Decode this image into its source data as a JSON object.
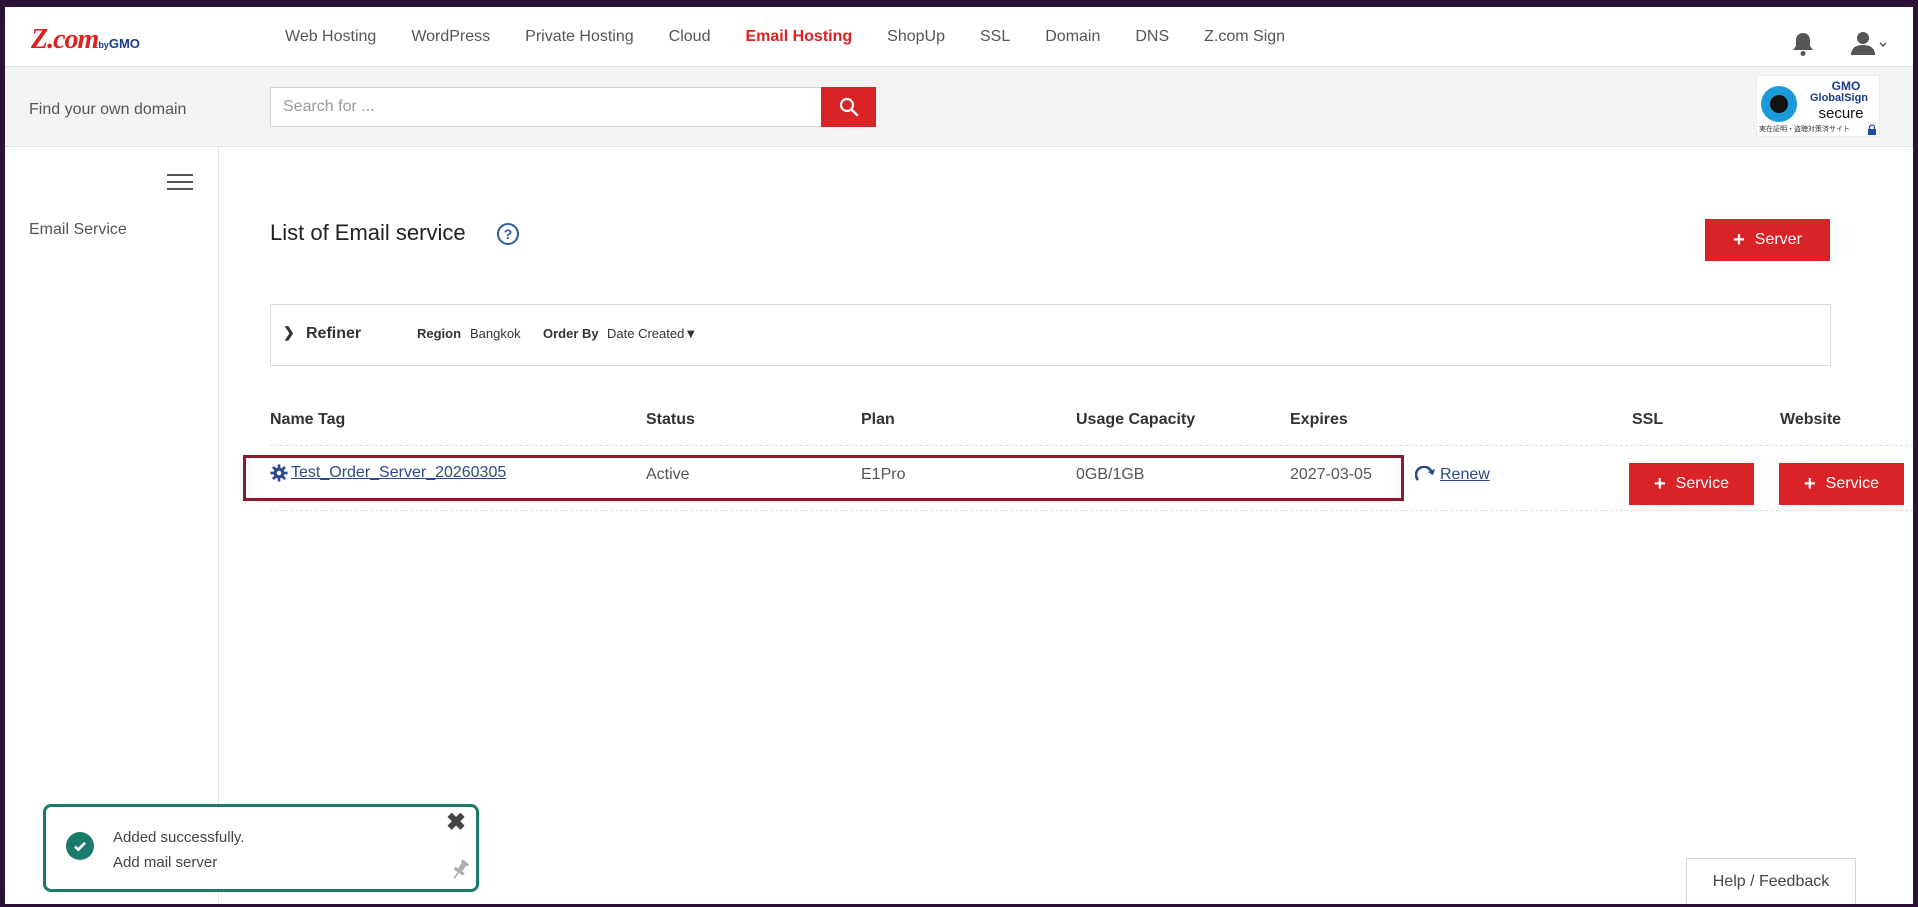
{
  "header": {
    "logo": {
      "main": "Z.com",
      "by": "by",
      "gmo": "GMO"
    },
    "nav": [
      {
        "label": "Web Hosting",
        "active": false
      },
      {
        "label": "WordPress",
        "active": false
      },
      {
        "label": "Private Hosting",
        "active": false
      },
      {
        "label": "Cloud",
        "active": false
      },
      {
        "label": "Email Hosting",
        "active": true
      },
      {
        "label": "ShopUp",
        "active": false
      },
      {
        "label": "SSL",
        "active": false
      },
      {
        "label": "Domain",
        "active": false
      },
      {
        "label": "DNS",
        "active": false
      },
      {
        "label": "Z.com Sign",
        "active": false
      }
    ],
    "icons": {
      "notifications": "bell-icon",
      "account": "user-icon"
    }
  },
  "search": {
    "label": "Find your own domain",
    "placeholder": "Search for ...",
    "value": "",
    "button_icon": "search-icon"
  },
  "badge": {
    "gmo": "GMO",
    "name": "GlobalSign",
    "secure": "secure",
    "small_text": "実在証明・盗聴対策済サイト"
  },
  "sidebar": {
    "menu_icon": "hamburger-icon",
    "items": [
      {
        "label": "Email Service"
      }
    ]
  },
  "main": {
    "title": "List of Email service",
    "help_icon": "question-circle-icon",
    "add_button": {
      "icon": "+",
      "label": "Server"
    },
    "refiner": {
      "label": "Refiner",
      "region_label": "Region",
      "region_value": "Bangkok",
      "order_label": "Order By",
      "order_value": "Date Created▼"
    },
    "table": {
      "columns": [
        "Name Tag",
        "Status",
        "Plan",
        "Usage Capacity",
        "Expires",
        "SSL",
        "Website"
      ],
      "rows": [
        {
          "name_tag": "Test_Order_Server_20260305",
          "status": "Active",
          "plan": "E1Pro",
          "usage": "0GB/1GB",
          "expires": "2027-03-05",
          "renew_label": "Renew",
          "ssl_button": "Service",
          "website_button": "Service"
        }
      ]
    }
  },
  "toast": {
    "title": "Added successfully.",
    "message": "Add mail server",
    "close": "✖"
  },
  "feedback": {
    "label": "Help / Feedback"
  },
  "colors": {
    "brand_red": "#d92326",
    "link_blue": "#2a4a8a",
    "success_green": "#1b7b6b",
    "highlight_border": "#8b1a2b"
  }
}
